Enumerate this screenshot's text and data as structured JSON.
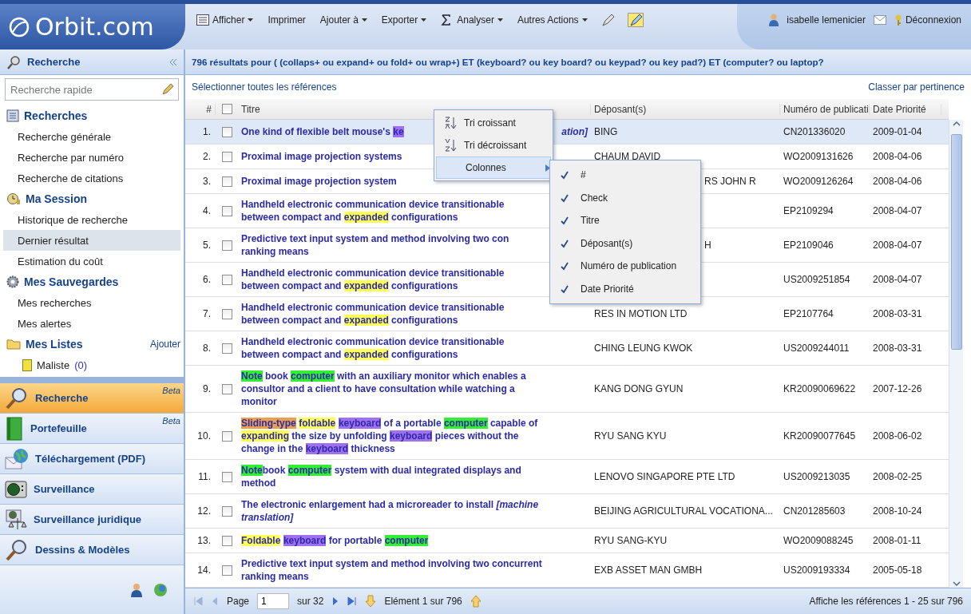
{
  "header": {
    "logo": "Orbit.com",
    "toolbar": [
      {
        "label": "Afficher",
        "kind": "listmenu",
        "dropdown": true
      },
      {
        "label": "Imprimer",
        "kind": "plain",
        "dropdown": false
      },
      {
        "label": "Ajouter à",
        "kind": "plain",
        "dropdown": true
      },
      {
        "label": "Exporter",
        "kind": "plain",
        "dropdown": true
      },
      {
        "label": "Analyser",
        "kind": "sigmamenu",
        "dropdown": true
      },
      {
        "label": "Autres Actions",
        "kind": "plain",
        "dropdown": true
      }
    ],
    "user": "isabelle lemenicier",
    "logout": "Déconnexion"
  },
  "sidebar": {
    "title": "Recherche",
    "search": {
      "placeholder": "Recherche rapide"
    },
    "groups": [
      {
        "label": "Recherches",
        "kind": "list",
        "items": [
          {
            "label": "Recherche générale",
            "selected": false
          },
          {
            "label": "Recherche par numéro",
            "selected": false
          },
          {
            "label": "Recherche de citations",
            "selected": false
          }
        ]
      },
      {
        "label": "Ma Session",
        "kind": "clock",
        "items": [
          {
            "label": "Historique de recherche",
            "selected": false
          },
          {
            "label": "Dernier résultat",
            "selected": true
          },
          {
            "label": "Estimation du coût",
            "selected": false
          }
        ]
      },
      {
        "label": "Mes Sauvegardes",
        "kind": "gear",
        "items": [
          {
            "label": "Mes recherches",
            "selected": false
          },
          {
            "label": "Mes alertes",
            "selected": false
          }
        ]
      },
      {
        "label": "Mes Listes",
        "kind": "folder",
        "action": "Ajouter",
        "items": [
          {
            "label": "Maliste",
            "count": "(0)",
            "selected": false
          }
        ]
      }
    ],
    "modules": [
      {
        "label": "Recherche",
        "badge": "Beta",
        "kind": "search",
        "selected": true
      },
      {
        "label": "Portefeuille",
        "badge": "Beta",
        "kind": "book",
        "selected": false
      },
      {
        "label": "Téléchargement (PDF)",
        "kind": "globe",
        "selected": false
      },
      {
        "label": "Surveillance",
        "kind": "radar",
        "selected": false
      },
      {
        "label": "Surveillance juridique",
        "kind": "scale",
        "selected": false
      },
      {
        "label": "Dessins & Modèles",
        "kind": "search",
        "selected": false
      }
    ]
  },
  "results": {
    "title": "796 résultats pour ( (collaps+ ou expand+ ou fold+ ou wrap+) ET (keyboard? ou key board? ou keypad? ou key pad?) ET (computer? ou laptop?",
    "select_all": "Sélectionner toutes les références",
    "sort": "Classer par pertinence",
    "columns": [
      "#",
      "Titre",
      "Déposant(s)",
      "Numéro de publicati",
      "Date Priorité"
    ],
    "header_checked": false,
    "rows": [
      {
        "num": "1.",
        "checked": false,
        "selected": true,
        "lines": [
          [
            {
              "text": "One kind of flexible belt mouse's "
            },
            {
              "text": "ke",
              "color": "#a070f0"
            }
          ]
        ],
        "title_end": "ation]",
        "depositor": "BING",
        "publication": "CN201336020",
        "date": "2009-01-04"
      },
      {
        "num": "2.",
        "checked": false,
        "selected": false,
        "lines": [
          [
            {
              "text": "Proximal image projection systems"
            }
          ]
        ],
        "depositor": "CHAUM DAVID",
        "publication": "WO2009131626",
        "date": "2008-04-06"
      },
      {
        "num": "3.",
        "checked": false,
        "selected": false,
        "lines": [
          [
            {
              "text": "Proximal image projection system"
            }
          ]
        ],
        "depositor": "RS JOHN R",
        "depositor_clipped": true,
        "publication": "WO2009126264",
        "date": "2008-04-06"
      },
      {
        "num": "4.",
        "checked": false,
        "selected": false,
        "lines": [
          [
            {
              "text": "Handheld electronic communication device transitionable"
            }
          ],
          [
            {
              "text": "between compact and "
            },
            {
              "text": "expanded",
              "color": "#ffff55"
            },
            {
              "text": " configurations"
            }
          ]
        ],
        "publication": "EP2109294",
        "date": "2008-04-07"
      },
      {
        "num": "5.",
        "checked": false,
        "selected": false,
        "lines": [
          [
            {
              "text": "Predictive text input system and method involving two con"
            }
          ],
          [
            {
              "text": "ranking means"
            }
          ]
        ],
        "depositor": "H",
        "depositor_clipped": true,
        "publication": "EP2109046",
        "date": "2008-04-07"
      },
      {
        "num": "6.",
        "checked": false,
        "selected": false,
        "lines": [
          [
            {
              "text": "Handheld electronic communication device transitionable"
            }
          ],
          [
            {
              "text": "between compact and "
            },
            {
              "text": "expanded",
              "color": "#ffff55"
            },
            {
              "text": " configurations"
            }
          ]
        ],
        "publication": "US2009251854",
        "date": "2008-04-07"
      },
      {
        "num": "7.",
        "checked": false,
        "selected": false,
        "lines": [
          [
            {
              "text": "Handheld electronic communication device transitionable"
            }
          ],
          [
            {
              "text": "between compact and "
            },
            {
              "text": "expanded",
              "color": "#ffff55"
            },
            {
              "text": " configurations"
            }
          ]
        ],
        "depositor": "RES IN MOTION LTD",
        "publication": "EP2107764",
        "date": "2008-03-31"
      },
      {
        "num": "8.",
        "checked": false,
        "selected": false,
        "lines": [
          [
            {
              "text": "Handheld electronic communication device transitionable"
            }
          ],
          [
            {
              "text": "between compact and "
            },
            {
              "text": "expanded",
              "color": "#ffff55"
            },
            {
              "text": " configurations"
            }
          ]
        ],
        "depositor": "CHING LEUNG KWOK",
        "publication": "US2009244011",
        "date": "2008-03-31"
      },
      {
        "num": "9.",
        "checked": false,
        "selected": false,
        "lines": [
          [
            {
              "text": "Note",
              "color": "#33ee33"
            },
            {
              "text": " book "
            },
            {
              "text": "computer",
              "color": "#33ee33"
            },
            {
              "text": " with an auxiliary monitor which enables a"
            }
          ],
          [
            {
              "text": "consultor and a client to have consultation while watching a"
            }
          ],
          [
            {
              "text": "monitor"
            }
          ]
        ],
        "depositor": "KANG DONG GYUN",
        "publication": "KR20090069622",
        "date": "2007-12-26"
      },
      {
        "num": "10.",
        "checked": false,
        "selected": false,
        "lines": [
          [
            {
              "text": "Sliding-type",
              "color": "#e8a050"
            },
            {
              "text": "foldable",
              "color": "#ffff55",
              "space_before": true
            },
            {
              "text": "keyboard",
              "color": "#a070f0",
              "space_before": true
            },
            {
              "text": " of a portable "
            },
            {
              "text": "computer",
              "color": "#33ee33"
            },
            {
              "text": " capable of"
            }
          ],
          [
            {
              "text": "expanding",
              "color": "#ffff55"
            },
            {
              "text": " the size by unfolding "
            },
            {
              "text": "keyboard",
              "color": "#a070f0"
            },
            {
              "text": " pieces without the"
            }
          ],
          [
            {
              "text": "change in the "
            },
            {
              "text": "keyboard",
              "color": "#a070f0"
            },
            {
              "text": " thickness"
            }
          ]
        ],
        "depositor": "RYU SANG KYU",
        "publication": "KR20090077645",
        "date": "2008-06-02"
      },
      {
        "num": "11.",
        "checked": false,
        "selected": false,
        "lines": [
          [
            {
              "text": "Note",
              "color": "#33ee33"
            },
            {
              "text": "book "
            },
            {
              "text": "computer",
              "color": "#33ee33"
            },
            {
              "text": " system with dual integrated displays and"
            }
          ],
          [
            {
              "text": "method"
            }
          ]
        ],
        "depositor": "LENOVO SINGAPORE PTE LTD",
        "publication": "US2009213035",
        "date": "2008-02-25"
      },
      {
        "num": "12.",
        "checked": false,
        "selected": false,
        "lines": [
          [
            {
              "text": "The electronic enlargement had a microreader to install *[machine*"
            }
          ],
          [
            {
              "text": "*translation]*"
            }
          ]
        ],
        "depositor": "BEIJING AGRICULTURAL VOCATIONA...",
        "publication": "CN201285603",
        "date": "2008-10-24"
      },
      {
        "num": "13.",
        "checked": false,
        "selected": false,
        "lines": [
          [
            {
              "text": "Foldable",
              "color": "#ffff55"
            },
            {
              "text": "keyboard",
              "color": "#a070f0",
              "space_before": true
            },
            {
              "text": " for portable "
            },
            {
              "text": "computer",
              "color": "#33ee33"
            }
          ]
        ],
        "depositor": "RYU SANG-KYU",
        "publication": "WO2009088245",
        "date": "2008-01-11"
      },
      {
        "num": "14.",
        "checked": false,
        "selected": false,
        "lines": [
          [
            {
              "text": "Predictive text input system and method involving two concurrent"
            }
          ],
          [
            {
              "text": "ranking means"
            }
          ]
        ],
        "depositor": "EXB ASSET MAN GMBH",
        "publication": "US2009193334",
        "date": "2005-05-18"
      }
    ]
  },
  "context_menu": {
    "items": [
      {
        "label": "Tri croissant",
        "kind": "asc",
        "selected": false
      },
      {
        "label": "Tri décroissant",
        "kind": "desc",
        "selected": false
      },
      {
        "label": "Colonnes",
        "kind": "submenu",
        "selected": true
      }
    ],
    "submenu": [
      {
        "label": "#",
        "checked": true
      },
      {
        "label": "Check",
        "checked": true
      },
      {
        "label": "Titre",
        "checked": true
      },
      {
        "label": "Déposant(s)",
        "checked": true
      },
      {
        "label": "Numéro de publication",
        "checked": true
      },
      {
        "label": "Date Priorité",
        "checked": true
      }
    ]
  },
  "pager": {
    "page_label": "Page",
    "page_value": "1",
    "page_total": "sur 32",
    "element": "Elément 1 sur 796",
    "summary": "Affiche les références 1 - 25 sur 796"
  }
}
